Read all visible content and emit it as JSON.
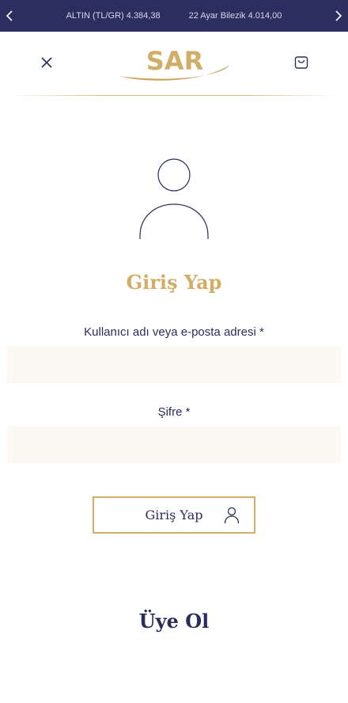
{
  "ticker": {
    "items": [
      "ALTIN (TL/GR) 4.384,38",
      "22 Ayar Bilezik 4.014,00"
    ]
  },
  "logo": {
    "text": "SAR"
  },
  "login": {
    "title": "Giriş Yap",
    "username_label": "Kullanıcı adı veya e-posta adresi *",
    "username_value": "",
    "password_label": "Şifre *",
    "password_value": "",
    "submit_label": "Giriş Yap"
  },
  "register": {
    "title": "Üye Ol"
  },
  "colors": {
    "navy": "#2c2e5f",
    "gold": "#d2ad66",
    "field_bg": "#fcf8f3"
  },
  "icons": {
    "ticker_prev": "chevron-left-icon",
    "ticker_next": "chevron-right-icon",
    "close": "close-icon",
    "cart": "shopping-bag-icon",
    "user": "user-icon"
  }
}
